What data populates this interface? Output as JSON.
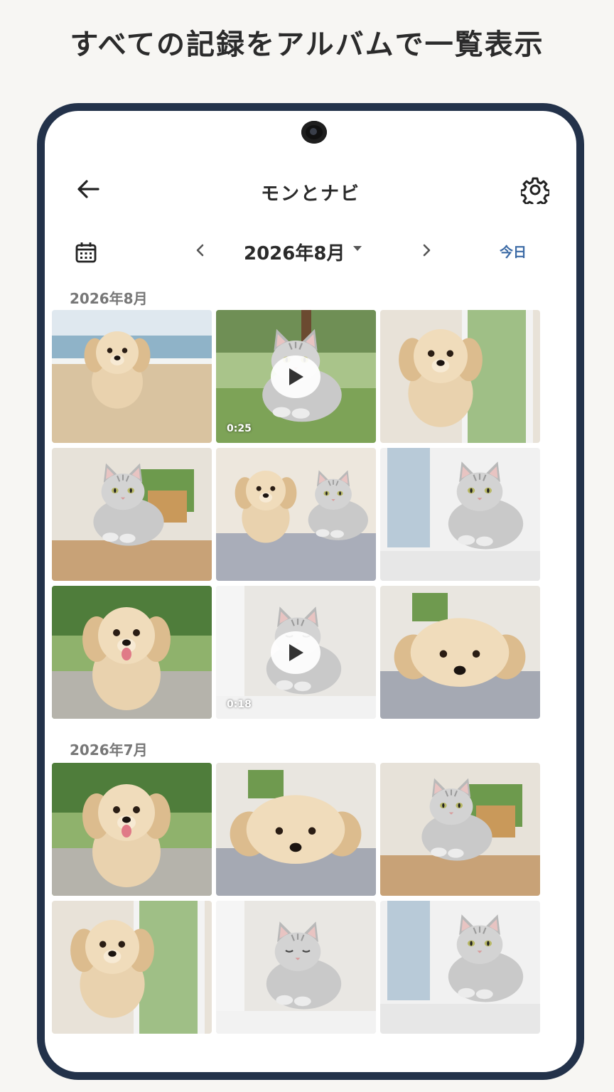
{
  "headline": "すべての記録をアルバムで一覧表示",
  "appbar": {
    "title": "モンとナビ",
    "back_icon": "arrow-left-icon",
    "settings_icon": "gear-icon"
  },
  "navbar": {
    "calendar_icon": "calendar-icon",
    "prev_icon": "chevron-left-icon",
    "next_icon": "chevron-right-icon",
    "month_label": "2026年8月",
    "dropdown_icon": "caret-down-icon",
    "today_label": "今日"
  },
  "sections": [
    {
      "label": "2026年8月",
      "items": [
        {
          "type": "photo",
          "subject": "dog-beach"
        },
        {
          "type": "video",
          "subject": "cat-grass",
          "duration": "0:25"
        },
        {
          "type": "photo",
          "subject": "dog-window"
        },
        {
          "type": "photo",
          "subject": "cat-table"
        },
        {
          "type": "photo",
          "subject": "dog-and-cat-bed"
        },
        {
          "type": "photo",
          "subject": "cat-window"
        },
        {
          "type": "photo",
          "subject": "dog-park"
        },
        {
          "type": "video",
          "subject": "cat-sleeping",
          "duration": "0:18"
        },
        {
          "type": "photo",
          "subject": "dog-lying"
        }
      ]
    },
    {
      "label": "2026年7月",
      "items": [
        {
          "type": "photo",
          "subject": "dog-park"
        },
        {
          "type": "photo",
          "subject": "dog-lying"
        },
        {
          "type": "photo",
          "subject": "cat-table"
        },
        {
          "type": "photo",
          "subject": "dog-window"
        },
        {
          "type": "photo",
          "subject": "cat-sleeping"
        },
        {
          "type": "photo",
          "subject": "cat-window"
        }
      ]
    }
  ],
  "colors": {
    "frame": "#23324a",
    "accent": "#3b6aa5",
    "background": "#f7f6f3"
  }
}
